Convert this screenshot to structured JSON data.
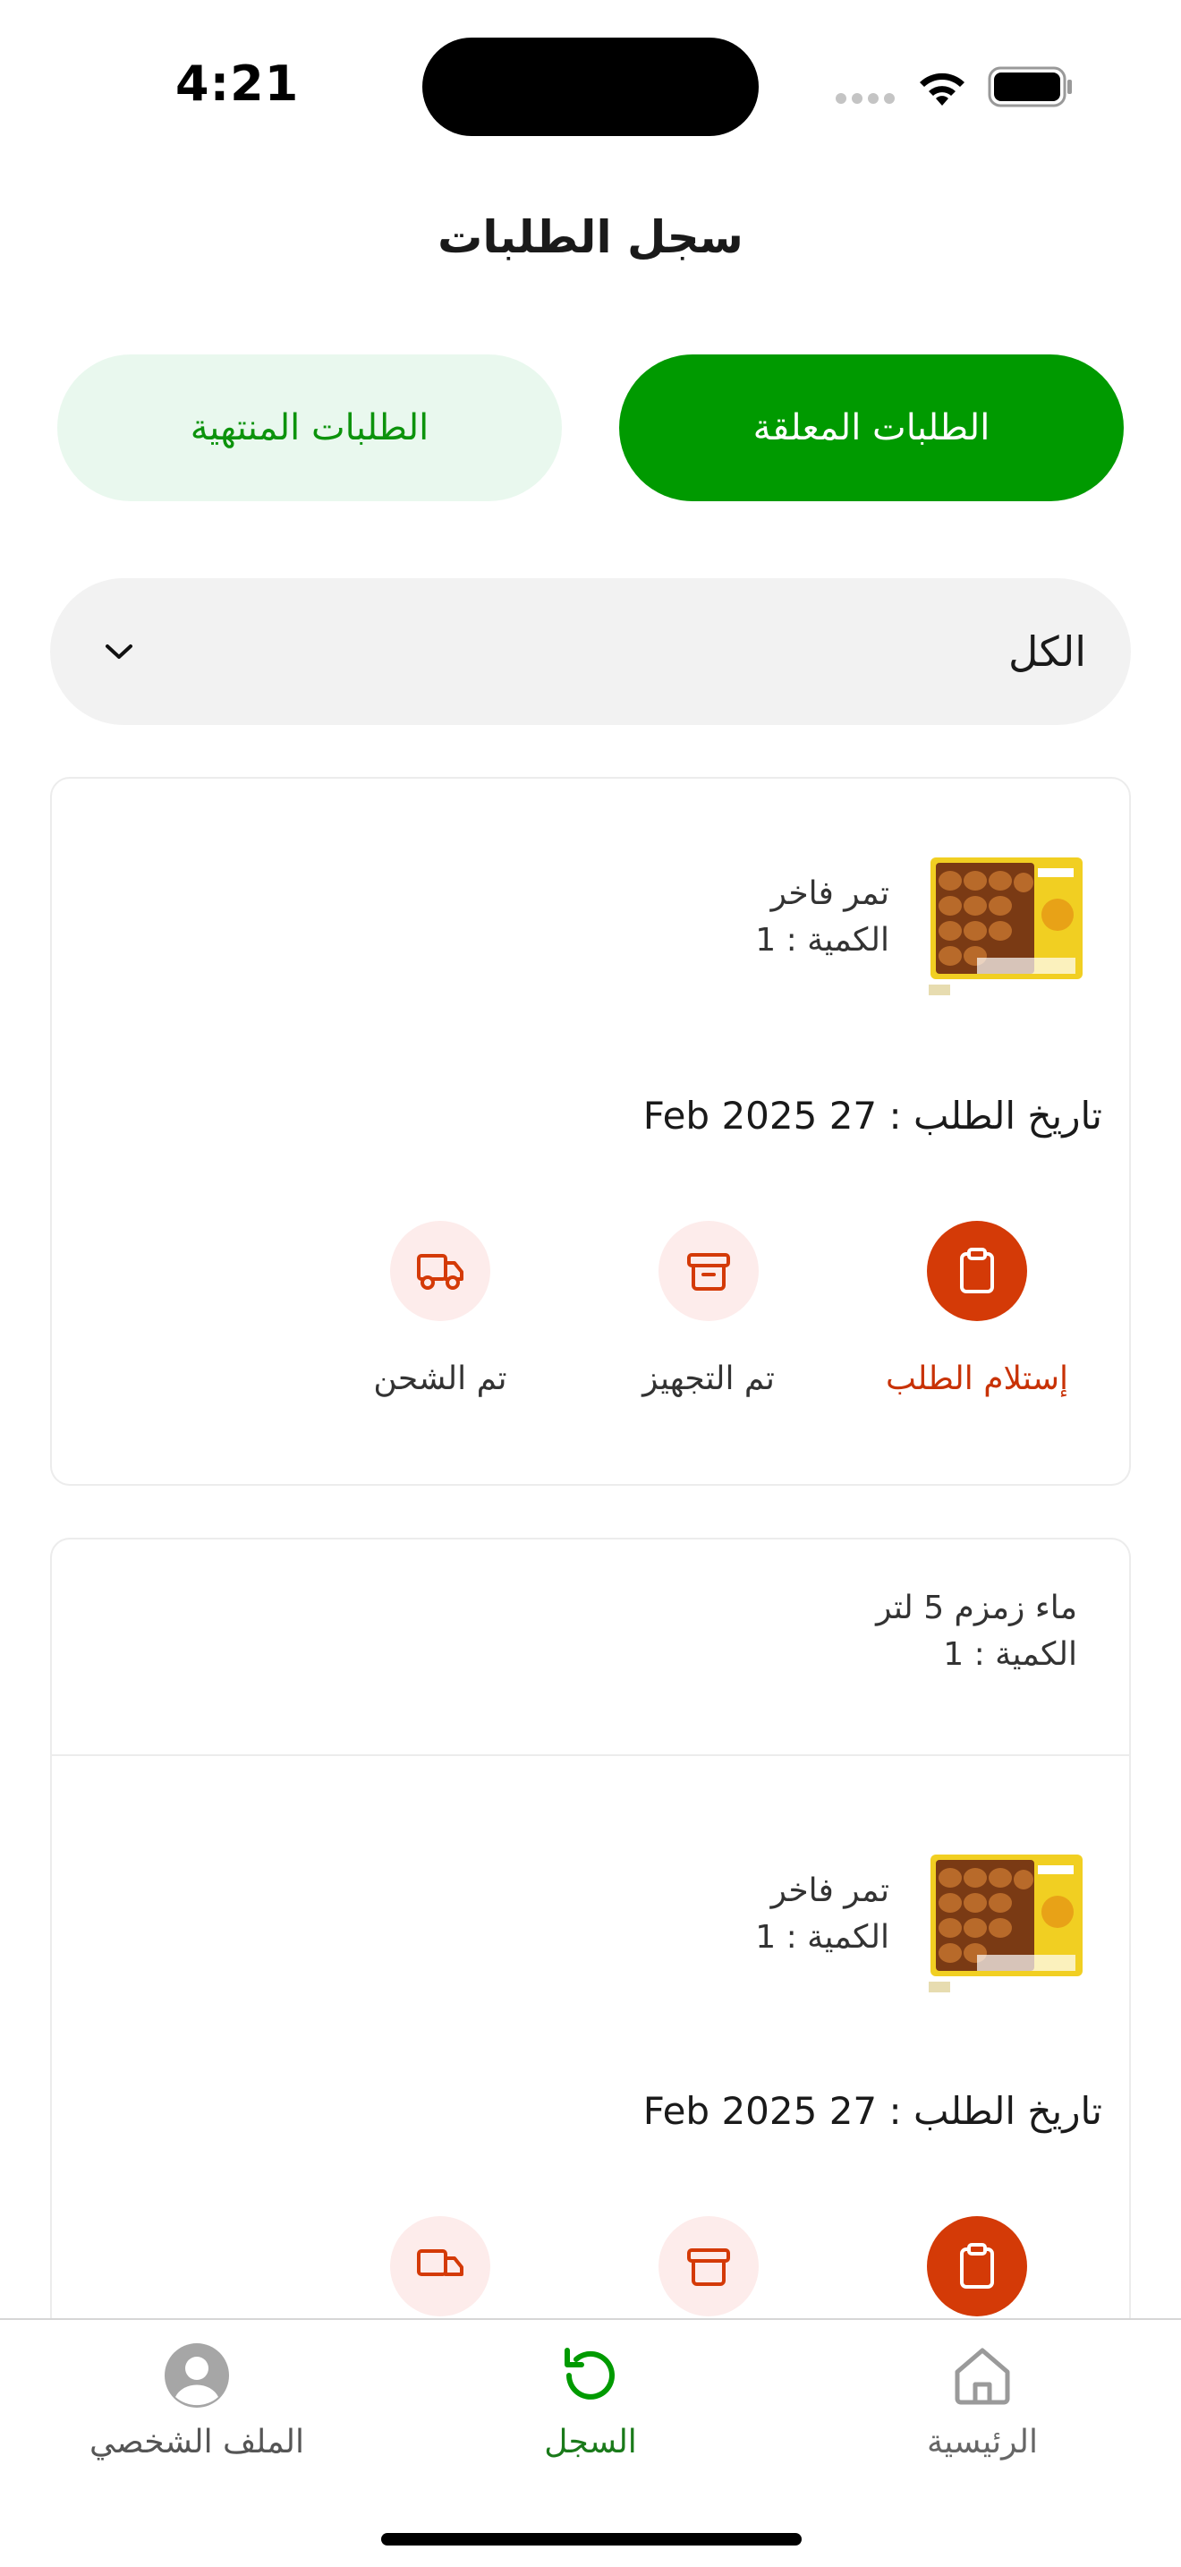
{
  "status_bar": {
    "time": "4:21"
  },
  "header": {
    "title": "سجل الطلبات"
  },
  "tabs": [
    {
      "label": "الطلبات المعلقة",
      "active": true
    },
    {
      "label": "الطلبات المنتهية",
      "active": false
    }
  ],
  "filter": {
    "value": "الكل"
  },
  "orders": [
    {
      "items": [
        {
          "name": "تمر فاخر",
          "quantity_label": "الكمية : 1"
        }
      ],
      "date_label": "تاريخ الطلب : 27 Feb 2025",
      "steps": [
        {
          "label": "إستلام الطلب",
          "icon": "clipboard-icon",
          "done": true
        },
        {
          "label": "تم التجهيز",
          "icon": "archive-box-icon",
          "done": false
        },
        {
          "label": "تم الشحن",
          "icon": "delivery-truck-icon",
          "done": false
        }
      ]
    },
    {
      "items": [
        {
          "name": "ماء زمزم 5 لتر",
          "quantity_label": "الكمية : 1"
        },
        {
          "name": "تمر فاخر",
          "quantity_label": "الكمية : 1"
        }
      ],
      "date_label": "تاريخ الطلب : 27 Feb 2025"
    }
  ],
  "bottom_nav": [
    {
      "label": "الرئيسية",
      "icon": "home-icon",
      "active": false
    },
    {
      "label": "السجل",
      "icon": "history-icon",
      "active": true
    },
    {
      "label": "الملف الشخصي",
      "icon": "profile-icon",
      "active": false
    }
  ],
  "colors": {
    "primary_green": "#009a00",
    "inactive_tab_bg": "#e9f8ee",
    "step_done": "#d43a07",
    "step_todo_bg": "#fdeceb"
  }
}
